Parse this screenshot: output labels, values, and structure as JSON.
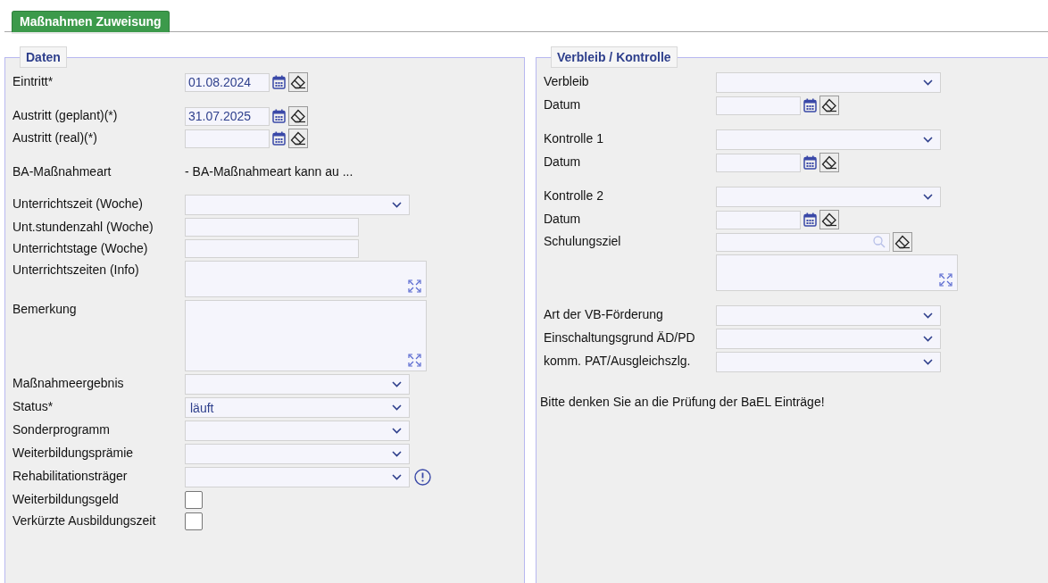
{
  "tab": {
    "label": "Maßnahmen Zuweisung",
    "selected": true
  },
  "panels": [
    {
      "title": "Daten",
      "groups": [
        [
          {
            "kind": "date",
            "label": "Eintritt*",
            "value": "01.08.2024"
          }
        ],
        [
          {
            "kind": "date",
            "label": "Austritt (geplant)(*)",
            "value": "31.07.2025"
          },
          {
            "kind": "date",
            "label": "Austritt (real)(*)"
          }
        ],
        [
          {
            "kind": "readonly",
            "label": "BA-Maßnahmeart",
            "value": "- BA-Maßnahmeart kann au ..."
          }
        ],
        [
          {
            "kind": "select",
            "label": "Unterrichtszeit (Woche)",
            "info": false
          },
          {
            "kind": "text",
            "label": "Unt.stundenzahl (Woche)"
          },
          {
            "kind": "text",
            "label": "Unterrichtstage (Woche)"
          },
          {
            "kind": "textarea",
            "label": "Unterrichtszeiten (Info)"
          },
          {
            "kind": "memo",
            "label": "Bemerkung"
          },
          {
            "kind": "select",
            "label": "Maßnahmeergebnis",
            "info": false
          },
          {
            "kind": "select",
            "label": "Status*",
            "value": "läuft",
            "info": false
          },
          {
            "kind": "select",
            "label": "Sonderprogramm",
            "info": false
          },
          {
            "kind": "select",
            "label": "Weiterbildungsprämie",
            "info": false
          },
          {
            "kind": "select",
            "label": "Rehabilitationsträger",
            "info": true
          },
          {
            "kind": "checkbox",
            "label": "Weiterbildungsgeld",
            "checked": false
          },
          {
            "kind": "checkbox",
            "label": "Verkürzte Ausbildungszeit",
            "checked": false
          }
        ]
      ]
    },
    {
      "title": "Verbleib / Kontrolle",
      "groups": [
        [
          {
            "kind": "select",
            "label": "Verbleib",
            "info": false
          },
          {
            "kind": "date",
            "label": "Datum"
          }
        ],
        [
          {
            "kind": "select",
            "label": "Kontrolle 1",
            "info": false
          },
          {
            "kind": "date",
            "label": "Datum"
          }
        ],
        [
          {
            "kind": "select",
            "label": "Kontrolle 2",
            "info": false
          },
          {
            "kind": "date",
            "label": "Datum"
          },
          {
            "kind": "lookup",
            "label": "Schulungsziel"
          },
          {
            "kind": "textarea"
          }
        ],
        [
          {
            "kind": "select",
            "label": "Art der VB-Förderung",
            "info": false
          },
          {
            "kind": "select",
            "label": "Einschaltungsgrund ÄD/PD",
            "info": false
          },
          {
            "kind": "select",
            "label": "komm. PAT/Ausgleichszlg.",
            "info": false
          }
        ]
      ],
      "note": "Bitte denken Sie an die Prüfung der BaEL Einträge!"
    }
  ]
}
